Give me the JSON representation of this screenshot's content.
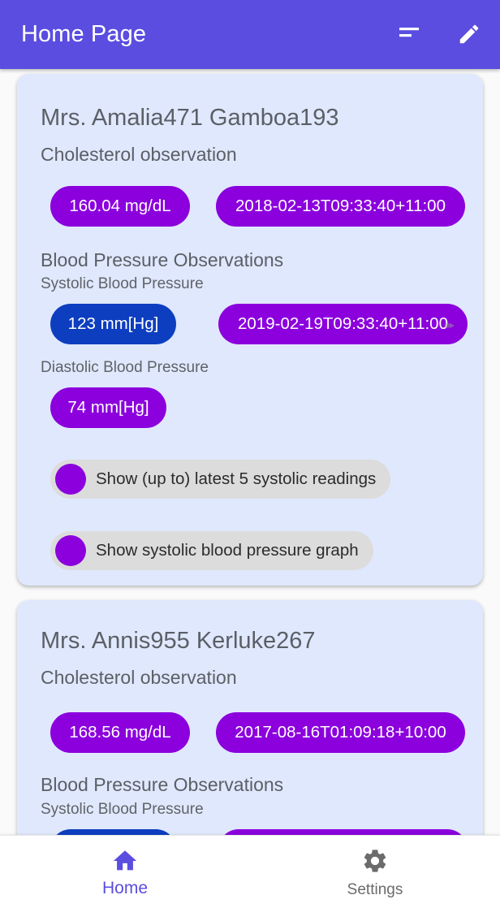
{
  "app_bar": {
    "title": "Home Page",
    "sort_icon": "sort-icon",
    "edit_icon": "pencil-icon"
  },
  "patients": [
    {
      "name": "Mrs. Amalia471 Gamboa193",
      "cholesterol_heading": "Cholesterol observation",
      "cholesterol_value": "160.04 mg/dL",
      "cholesterol_date": "2018-02-13T09:33:40+11:00",
      "bp_heading": "Blood Pressure Observations",
      "systolic_label": "Systolic Blood Pressure",
      "systolic_value": "123 mm[Hg]",
      "systolic_date": "2019-02-19T09:33:40+11:00",
      "diastolic_label": "Diastolic Blood Pressure",
      "diastolic_value": "74 mm[Hg]",
      "toggle_latest": "Show (up to) latest 5 systolic readings",
      "toggle_graph": "Show systolic blood pressure graph"
    },
    {
      "name": "Mrs. Annis955 Kerluke267",
      "cholesterol_heading": "Cholesterol observation",
      "cholesterol_value": "168.56 mg/dL",
      "cholesterol_date": "2017-08-16T01:09:18+10:00",
      "bp_heading": "Blood Pressure Observations",
      "systolic_label": "Systolic Blood Pressure"
    }
  ],
  "bottom_nav": {
    "items": [
      {
        "label": "Home",
        "icon": "home-icon",
        "active": true
      },
      {
        "label": "Settings",
        "icon": "gear-icon",
        "active": false
      }
    ]
  },
  "colors": {
    "primary": "#5a4de0",
    "chip_purple": "#8b00dd",
    "chip_blue": "#0d3ebf",
    "card_background": "#e0e8fd"
  }
}
